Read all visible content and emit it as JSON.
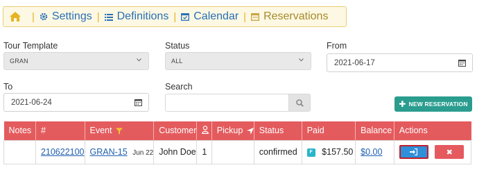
{
  "nav": {
    "items": [
      {
        "label": "Settings"
      },
      {
        "label": "Definitions"
      },
      {
        "label": "Calendar"
      },
      {
        "label": "Reservations"
      }
    ],
    "separator": "|"
  },
  "filters": {
    "tour_template": {
      "label": "Tour Template",
      "value": "GRAN"
    },
    "status": {
      "label": "Status",
      "value": "ALL"
    },
    "from": {
      "label": "From",
      "value": "2021-06-17"
    },
    "to": {
      "label": "To",
      "value": "2021-06-24"
    },
    "search": {
      "label": "Search",
      "value": ""
    }
  },
  "new_reservation_label": "NEW RESERVATION",
  "table": {
    "headers": {
      "notes": "Notes",
      "number": "#",
      "event": "Event",
      "customer": "Customer",
      "pickup": "Pickup",
      "status": "Status",
      "paid": "Paid",
      "balance": "Balance",
      "actions": "Actions"
    },
    "row": {
      "notes": "",
      "number": "210622100",
      "event": "GRAN-15",
      "event_date": "Jun 22",
      "customer": "John Doe",
      "persons": "1",
      "pickup": "",
      "status": "confirmed",
      "paid_badge": "F",
      "paid": "$157.50",
      "balance": "$0.00"
    }
  },
  "colors": {
    "nav_bg": "#fcf8e3",
    "header_red": "#e45b5e",
    "new_reservation_green": "#2a9d8f",
    "login_blue": "#2f8fd8",
    "delete_red": "#e55a5f"
  }
}
